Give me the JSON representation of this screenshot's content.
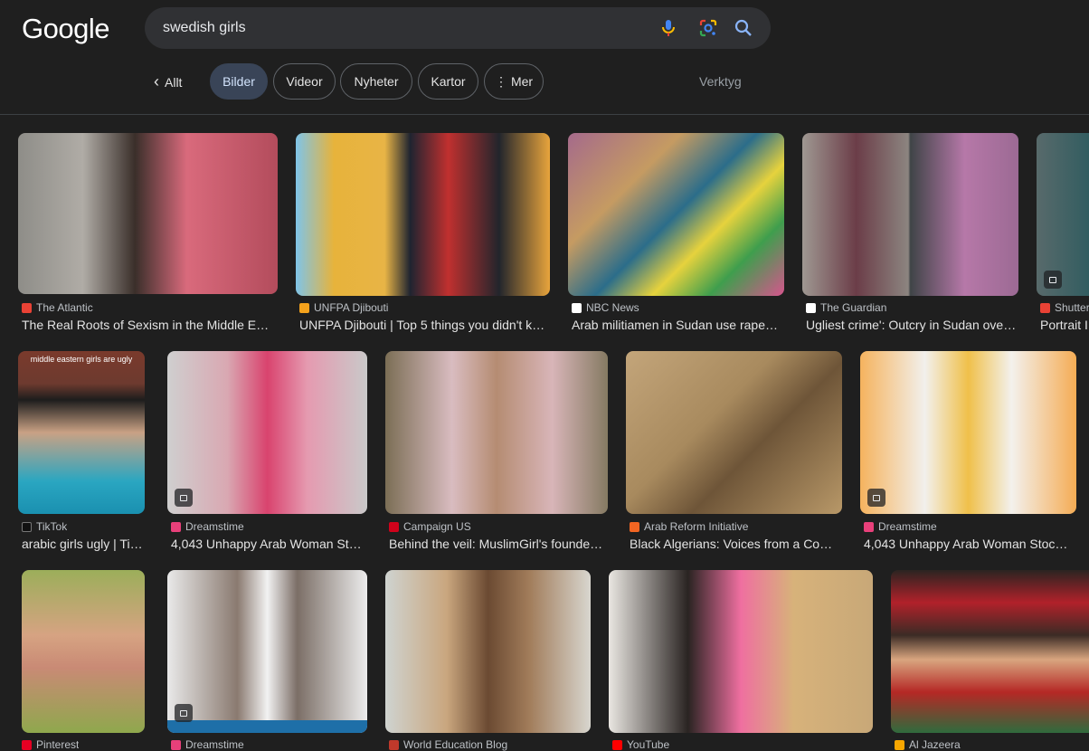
{
  "logo": "Google",
  "search": {
    "query": "swedish girls"
  },
  "nav": {
    "back_label": "Allt",
    "chips": [
      "Bilder",
      "Videor",
      "Nyheter",
      "Kartor",
      "Mer"
    ],
    "tools": "Verktyg"
  },
  "colors": {
    "background": "#1f1f1f",
    "chip_active": "#394457",
    "search_bg": "#303134"
  },
  "results": [
    {
      "source": "The Atlantic",
      "title": "The Real Roots of Sexism in the Middle E…",
      "fav_color": "#e94235"
    },
    {
      "source": "UNFPA Djibouti",
      "title": "UNFPA Djibouti | Top 5 things you didn't k…",
      "fav_color": "#f4a21c"
    },
    {
      "source": "NBC News",
      "title": "Arab militiamen in Sudan use rape…",
      "fav_color": "#ffffff"
    },
    {
      "source": "The Guardian",
      "title": "Ugliest crime': Outcry in Sudan ove…",
      "fav_color": "#ffffff"
    },
    {
      "source": "Shutter",
      "title": "Portrait I",
      "fav_color": "#e94235"
    },
    {
      "source": "TikTok",
      "title": "arabic girls ugly | Ti…",
      "fav_color": "#111111",
      "overlay": "middle eastern girls are ugly"
    },
    {
      "source": "Dreamstime",
      "title": "4,043 Unhappy Arab Woman St…",
      "fav_color": "#e8407a"
    },
    {
      "source": "Campaign US",
      "title": "Behind the veil: MuslimGirl's founde…",
      "fav_color": "#d0021b"
    },
    {
      "source": "Arab Reform Initiative",
      "title": "Black Algerians: Voices from a Co…",
      "fav_color": "#f26522"
    },
    {
      "source": "Dreamstime",
      "title": "4,043 Unhappy Arab Woman Stoc…",
      "fav_color": "#e8407a"
    },
    {
      "source": "Pinterest",
      "title": "",
      "fav_color": "#e60023"
    },
    {
      "source": "Dreamstime",
      "title": "",
      "fav_color": "#e8407a"
    },
    {
      "source": "World Education Blog",
      "title": "",
      "fav_color": "#c0392b"
    },
    {
      "source": "YouTube",
      "title": "",
      "fav_color": "#ff0000"
    },
    {
      "source": "Al Jazeera",
      "title": "",
      "fav_color": "#f7a600"
    }
  ]
}
